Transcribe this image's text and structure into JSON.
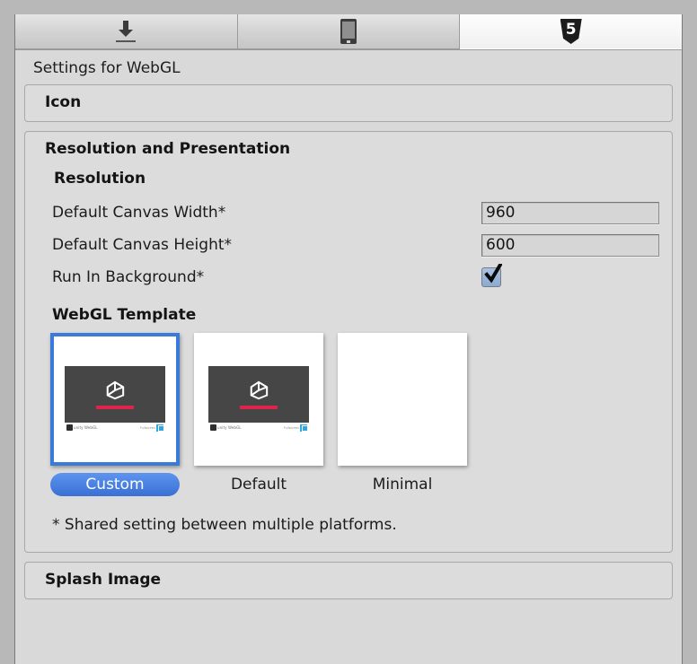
{
  "window": {
    "title": "Settings for WebGL"
  },
  "platform_tabs": [
    {
      "name": "standalone",
      "icon": "download-arrow-icon",
      "selected": false
    },
    {
      "name": "mobile",
      "icon": "mobile-device-icon",
      "selected": false
    },
    {
      "name": "webgl",
      "icon": "html5-shield-icon",
      "icon_text": "5",
      "selected": true
    }
  ],
  "sections": {
    "icon": {
      "label": "Icon"
    },
    "resolution_and_presentation": {
      "label": "Resolution and Presentation",
      "subsection": "Resolution",
      "fields": [
        {
          "label": "Default Canvas Width*",
          "value": "960",
          "type": "text"
        },
        {
          "label": "Default Canvas Height*",
          "value": "600",
          "type": "text"
        },
        {
          "label": "Run In Background*",
          "value": "",
          "type": "checkbox",
          "checked": true
        }
      ],
      "template": {
        "label": "WebGL Template",
        "options": [
          {
            "label": "Custom",
            "selected": true,
            "preview": "unity-loader"
          },
          {
            "label": "Default",
            "selected": false,
            "preview": "unity-loader"
          },
          {
            "label": "Minimal",
            "selected": false,
            "preview": "blank"
          }
        ]
      },
      "footnote": "* Shared setting between multiple platforms."
    },
    "splash_image": {
      "label": "Splash Image"
    }
  },
  "colors": {
    "accent": "#3a7ad8",
    "progress_bar": "#e0234b",
    "panel_bg": "#d9d9d9",
    "checkbox_fill": "#89aad2"
  }
}
